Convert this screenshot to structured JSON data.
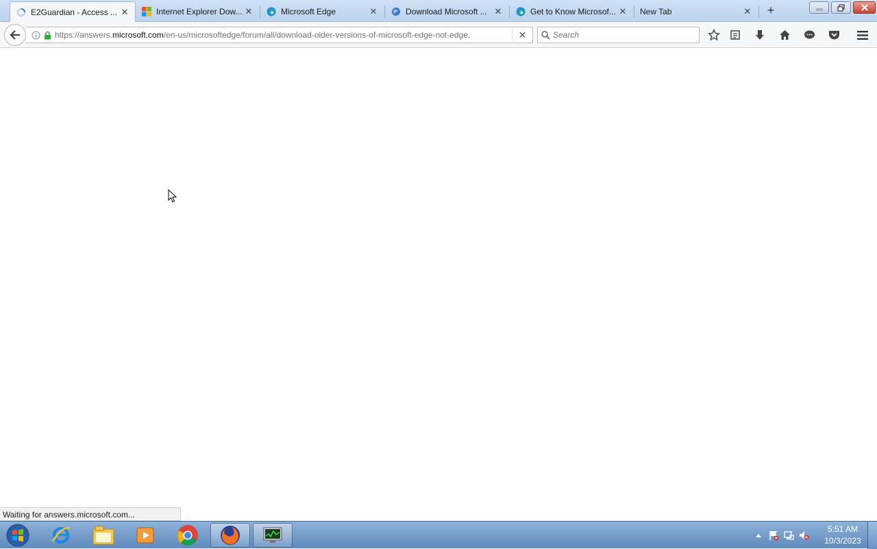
{
  "tabs": [
    {
      "label": "E2Guardian - Access ...",
      "icon": "loading-spinner-icon",
      "active": true
    },
    {
      "label": "Internet Explorer Dow...",
      "icon": "microsoft-logo-icon"
    },
    {
      "label": "Microsoft Edge",
      "icon": "edge-icon"
    },
    {
      "label": "Download Microsoft ...",
      "icon": "globe-icon"
    },
    {
      "label": "Get to Know Microsof...",
      "icon": "edge-icon"
    },
    {
      "label": "New Tab",
      "icon": ""
    }
  ],
  "navbar": {
    "url_prefix": "https://answers.",
    "url_host": "microsoft.com",
    "url_path": "/en-us/microsoftedge/forum/all/download-older-versions-of-microsoft-edge-not-edge,",
    "search_placeholder": "Search"
  },
  "status": {
    "text": "Waiting for answers.microsoft.com..."
  },
  "taskbar": {
    "apps": [
      "internet-explorer",
      "file-explorer",
      "media-player",
      "chrome",
      "firefox",
      "task-manager"
    ],
    "clock_time": "5:51 AM",
    "clock_date": "10/3/2023"
  }
}
